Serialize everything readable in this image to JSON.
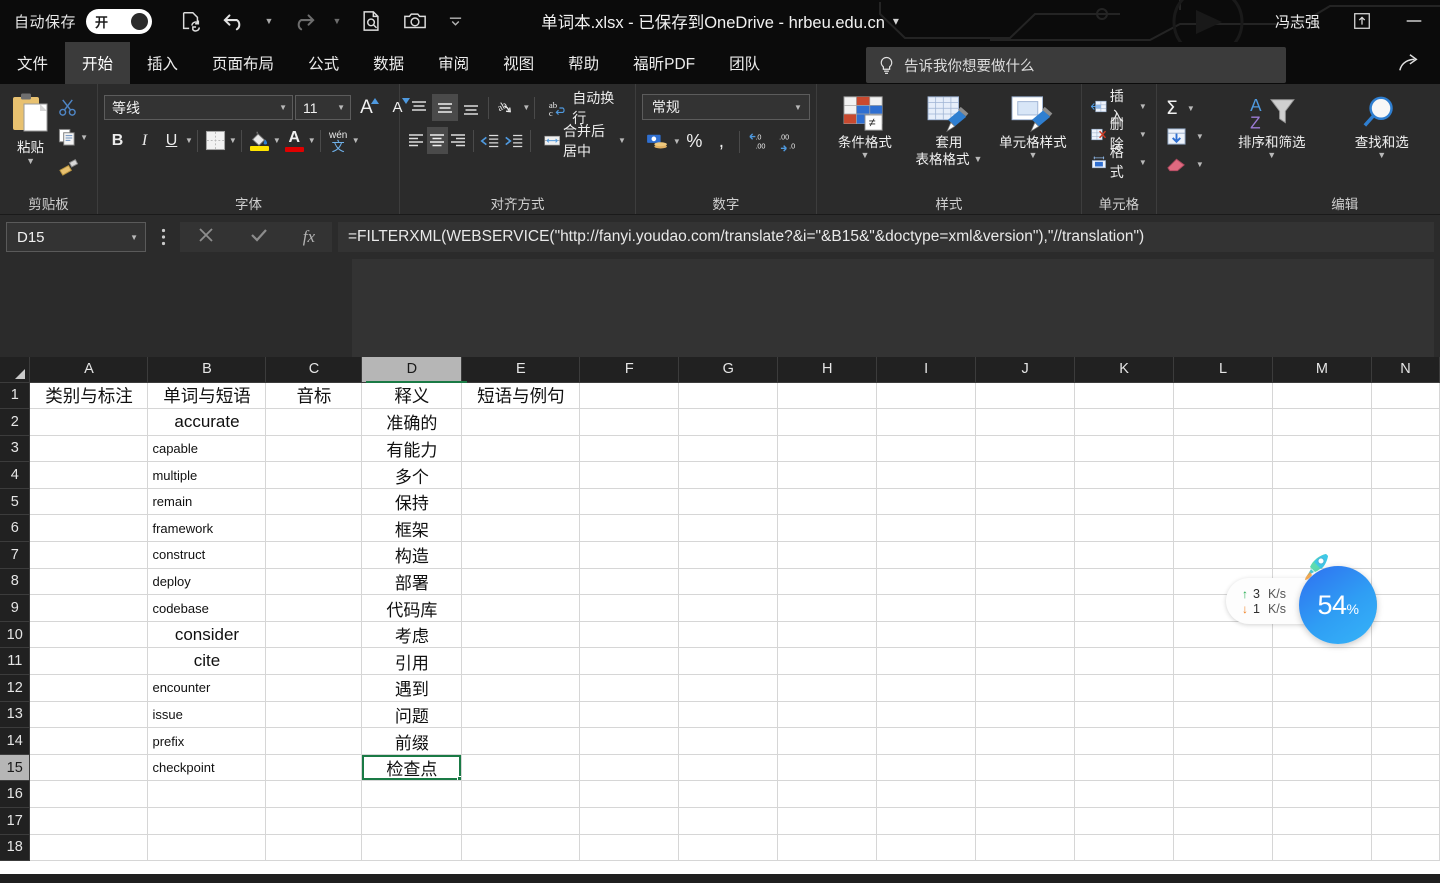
{
  "titlebar": {
    "autosave_label": "自动保存",
    "autosave_state": "开",
    "qat_icons": [
      "save-icon",
      "undo-icon",
      "redo-icon",
      "print-preview-icon",
      "camera-icon",
      "customize-qat-icon"
    ],
    "document_title": "单词本.xlsx  -  已保存到OneDrive - hrbeu.edu.cn",
    "title_caret": "▾",
    "user_name": "冯志强",
    "restore_icon": "restore-window-icon",
    "minimize_icon": "minimize-window-icon"
  },
  "ribbon_tabs": {
    "items": [
      {
        "label": "文件",
        "active": false
      },
      {
        "label": "开始",
        "active": true
      },
      {
        "label": "插入",
        "active": false
      },
      {
        "label": "页面布局",
        "active": false
      },
      {
        "label": "公式",
        "active": false
      },
      {
        "label": "数据",
        "active": false
      },
      {
        "label": "审阅",
        "active": false
      },
      {
        "label": "视图",
        "active": false
      },
      {
        "label": "帮助",
        "active": false
      },
      {
        "label": "福昕PDF",
        "active": false
      },
      {
        "label": "团队",
        "active": false
      }
    ],
    "tellme_placeholder": "告诉我你想要做什么",
    "share_icon": "share-icon"
  },
  "ribbon": {
    "clipboard": {
      "title": "剪贴板",
      "paste_label": "粘贴",
      "cut_label": "剪切",
      "copy_label": "复制",
      "format_painter_label": "格式刷"
    },
    "font": {
      "title": "字体",
      "font_name": "等线",
      "font_size": "11",
      "bold": "B",
      "italic": "I",
      "underline": "U",
      "grow_font": "A",
      "shrink_font": "A",
      "phonetic_top": "wén",
      "phonetic_bottom": "文",
      "highlight_color": "#ffe400",
      "font_color": "#e00000"
    },
    "alignment": {
      "title": "对齐方式",
      "wrap_text_label": "自动换行",
      "merge_center_label": "合并后居中",
      "orientation_icon": "text-orientation-icon"
    },
    "number": {
      "title": "数字",
      "format": "常规",
      "percent": "%",
      "comma": "❟",
      "inc_dec": ".00",
      "dec_dec": ".00"
    },
    "styles": {
      "title": "样式",
      "conditional_label": "条件格式",
      "table_label_1": "套用",
      "table_label_2": "表格格式",
      "cellstyle_label": "单元格样式"
    },
    "cells": {
      "title": "单元格",
      "insert_label": "插入",
      "delete_label": "删除",
      "format_label": "格式"
    },
    "editing": {
      "title": "编辑",
      "autosum_icon": "sigma-icon",
      "fill_icon": "fill-down-icon",
      "clear_icon": "eraser-icon",
      "sort_filter_label": "排序和筛选",
      "find_select_label": "查找和选"
    }
  },
  "formula_bar": {
    "name_box": "D15",
    "name_box_caret": "▾",
    "cancel_icon": "cancel-icon",
    "confirm_icon": "confirm-icon",
    "fx_icon": "fx-icon",
    "formula": "=FILTERXML(WEBSERVICE(\"http://fanyi.youdao.com/translate?&i=\"&B15&\"&doctype=xml&version\"),\"//translation\")"
  },
  "grid": {
    "columns": [
      "A",
      "B",
      "C",
      "D",
      "E",
      "F",
      "G",
      "H",
      "I",
      "J",
      "K",
      "L",
      "M",
      "N"
    ],
    "selected_column": "D",
    "selected_row": 15,
    "selected_cell": "D15",
    "rows": [
      {
        "n": 1,
        "A": "类别与标注",
        "B": "单词与短语",
        "C": "音标",
        "D": "释义",
        "E": "短语与例句",
        "style": "header"
      },
      {
        "n": 2,
        "A": "",
        "B": "accurate",
        "C": "",
        "D": "准确的",
        "E": "",
        "style": "big"
      },
      {
        "n": 3,
        "A": "",
        "B": "capable",
        "C": "",
        "D": "有能力",
        "E": "",
        "style": "small"
      },
      {
        "n": 4,
        "A": "",
        "B": "multiple",
        "C": "",
        "D": "多个",
        "E": "",
        "style": "small"
      },
      {
        "n": 5,
        "A": "",
        "B": "remain",
        "C": "",
        "D": "保持",
        "E": "",
        "style": "small"
      },
      {
        "n": 6,
        "A": "",
        "B": "framework",
        "C": "",
        "D": "框架",
        "E": "",
        "style": "small"
      },
      {
        "n": 7,
        "A": "",
        "B": "construct",
        "C": "",
        "D": "构造",
        "E": "",
        "style": "small"
      },
      {
        "n": 8,
        "A": "",
        "B": "deploy",
        "C": "",
        "D": "部署",
        "E": "",
        "style": "small"
      },
      {
        "n": 9,
        "A": "",
        "B": "codebase",
        "C": "",
        "D": "代码库",
        "E": "",
        "style": "small"
      },
      {
        "n": 10,
        "A": "",
        "B": "consider",
        "C": "",
        "D": "考虑",
        "E": "",
        "style": "big"
      },
      {
        "n": 11,
        "A": "",
        "B": "cite",
        "C": "",
        "D": "引用",
        "E": "",
        "style": "big"
      },
      {
        "n": 12,
        "A": "",
        "B": "encounter",
        "C": "",
        "D": "遇到",
        "E": "",
        "style": "small"
      },
      {
        "n": 13,
        "A": "",
        "B": "issue",
        "C": "",
        "D": "问题",
        "E": "",
        "style": "small"
      },
      {
        "n": 14,
        "A": "",
        "B": "prefix",
        "C": "",
        "D": "前缀",
        "E": "",
        "style": "small"
      },
      {
        "n": 15,
        "A": "",
        "B": "checkpoint",
        "C": "",
        "D": "检查点",
        "E": "",
        "style": "small"
      },
      {
        "n": 16,
        "A": "",
        "B": "",
        "C": "",
        "D": "",
        "E": "",
        "style": "small"
      },
      {
        "n": 17,
        "A": "",
        "B": "",
        "C": "",
        "D": "",
        "E": "",
        "style": "small"
      },
      {
        "n": 18,
        "A": "",
        "B": "",
        "C": "",
        "D": "",
        "E": "",
        "style": "small"
      }
    ]
  },
  "net_widget": {
    "upload_arrow": "↑",
    "upload_value": "3",
    "upload_unit": "K/s",
    "download_arrow": "↓",
    "download_value": "1",
    "download_unit": "K/s",
    "percent_value": "54",
    "percent_symbol": "%",
    "ring_color": "#f5a03c",
    "circle_color": "#2f9ef4",
    "rocket_icon": "rocket-icon"
  }
}
